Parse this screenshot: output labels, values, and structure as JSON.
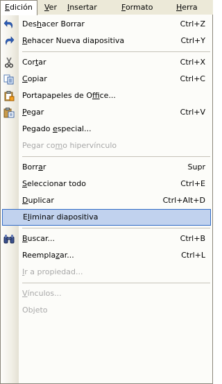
{
  "menubar": {
    "items": [
      {
        "pre": "",
        "key": "E",
        "post": "dición"
      },
      {
        "pre": "",
        "key": "V",
        "post": "er"
      },
      {
        "pre": "",
        "key": "I",
        "post": "nsertar"
      },
      {
        "pre": "",
        "key": "F",
        "post": "ormato"
      },
      {
        "pre": "",
        "key": "H",
        "post": "erra"
      }
    ]
  },
  "menu": {
    "items": [
      {
        "pre": "Des",
        "key": "h",
        "post": "acer Borrar",
        "shortcut": "Ctrl+Z",
        "icon": "undo-icon"
      },
      {
        "pre": "",
        "key": "R",
        "post": "ehacer Nueva diapositiva",
        "shortcut": "Ctrl+Y",
        "icon": "redo-icon"
      },
      {
        "pre": "Cor",
        "key": "t",
        "post": "ar",
        "shortcut": "Ctrl+X",
        "icon": "scissors-icon"
      },
      {
        "pre": "",
        "key": "C",
        "post": "opiar",
        "shortcut": "Ctrl+C",
        "icon": "copy-icon"
      },
      {
        "pre": "Portapapeles de O",
        "key": "f",
        "post": "fice...",
        "shortcut": "",
        "icon": "office-clipboard-icon"
      },
      {
        "pre": "",
        "key": "P",
        "post": "egar",
        "shortcut": "Ctrl+V",
        "icon": "paste-icon"
      },
      {
        "pre": "Pegado ",
        "key": "e",
        "post": "special...",
        "shortcut": ""
      },
      {
        "pre": "Pegar co",
        "key": "m",
        "post": "o hipervínculo",
        "shortcut": ""
      },
      {
        "pre": "Borr",
        "key": "a",
        "post": "r",
        "shortcut": "Supr"
      },
      {
        "pre": "",
        "key": "S",
        "post": "eleccionar todo",
        "shortcut": "Ctrl+E"
      },
      {
        "pre": "",
        "key": "D",
        "post": "uplicar",
        "shortcut": "Ctrl+Alt+D"
      },
      {
        "pre": "E",
        "key": "l",
        "post": "iminar diapositiva",
        "shortcut": ""
      },
      {
        "pre": "",
        "key": "B",
        "post": "uscar...",
        "shortcut": "Ctrl+B",
        "icon": "binoculars-icon"
      },
      {
        "pre": "Reempla",
        "key": "z",
        "post": "ar...",
        "shortcut": "Ctrl+L"
      },
      {
        "pre": "",
        "key": "I",
        "post": "r a propiedad...",
        "shortcut": ""
      },
      {
        "pre": "",
        "key": "V",
        "post": "ínculos...",
        "shortcut": ""
      },
      {
        "pre": "",
        "key": "",
        "post": "Objeto",
        "shortcut": ""
      }
    ]
  },
  "colors": {
    "highlight_bg": "#c1d2ee",
    "highlight_border": "#316ac5",
    "disabled_text": "#a8a8a8",
    "menubar_bg": "#ece9d8"
  }
}
